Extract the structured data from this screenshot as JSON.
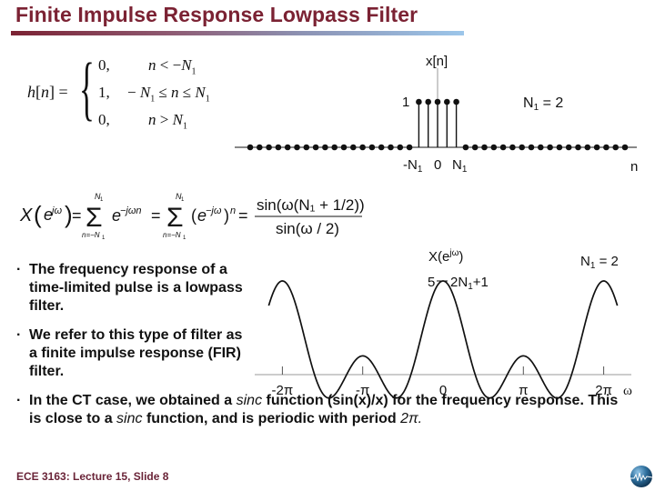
{
  "slide": {
    "title": "Finite Impulse Response Lowpass Filter",
    "footer": "ECE 3163: Lecture 15, Slide 8",
    "logo_icon": "globe-waveform-icon",
    "accent_color": "#7b2233"
  },
  "equations": {
    "impulse_response": {
      "lhs": "h[n] =",
      "cases": [
        {
          "value": "0,",
          "condition": "n < −N₁"
        },
        {
          "value": "1,",
          "condition": "− N₁ ≤ n ≤ N₁"
        },
        {
          "value": "0,",
          "condition": "n > N₁"
        }
      ]
    },
    "dtft": {
      "lhs": "X(e^{jω}) =",
      "sum1": "Σ_{n=−N₁}^{N₁} e^{−jωn}",
      "sum2": "Σ_{n=−N₁}^{N₁} (e^{−jω})^n",
      "numerator": "sin(ω(N₁ + 1/2))",
      "denominator": "sin(ω / 2)"
    }
  },
  "bullets": [
    {
      "text": "The frequency response of a time-limited pulse is a lowpass filter."
    },
    {
      "text": "We refer to this type of filter as a finite impulse response (FIR) filter."
    },
    {
      "parts": [
        {
          "t": "In the CT case, we obtained a ",
          "i": false
        },
        {
          "t": "sinc",
          "i": true
        },
        {
          "t": " function (sin(x)/x) for the frequency response. This is close to a ",
          "i": false
        },
        {
          "t": "sinc",
          "i": true
        },
        {
          "t": " function, and is periodic with period ",
          "i": false
        },
        {
          "t": "2π.",
          "i": true
        }
      ]
    }
  ],
  "chart_data": [
    {
      "type": "stem",
      "title": "x[n]",
      "xlabel": "n",
      "annotation": "N₁ = 2",
      "n_range": [
        -20,
        20
      ],
      "nonzero": {
        "n": [
          -2,
          -1,
          0,
          1,
          2
        ],
        "values": [
          1,
          1,
          1,
          1,
          1
        ]
      },
      "zero_elsewhere": true,
      "tick_labels": [
        "-N₁",
        "0",
        "N₁"
      ],
      "y_tick_labels": [
        "1"
      ]
    },
    {
      "type": "line",
      "title": "X(e^{jω})",
      "xlabel": "ω",
      "annotation": "N₁ = 2",
      "N1": 2,
      "function": "sin(ω(N₁+1/2)) / sin(ω/2)",
      "x_range_pi": [
        -2.17,
        2.17
      ],
      "ylim": [
        -1.3,
        5
      ],
      "peak_label": "5",
      "peak_annotation": "2N₁+1",
      "x_ticks_pi": [
        -2,
        -1,
        0,
        1,
        2
      ],
      "x_tick_labels": [
        "-2π",
        "-π",
        "0",
        "π",
        "2π"
      ]
    }
  ]
}
